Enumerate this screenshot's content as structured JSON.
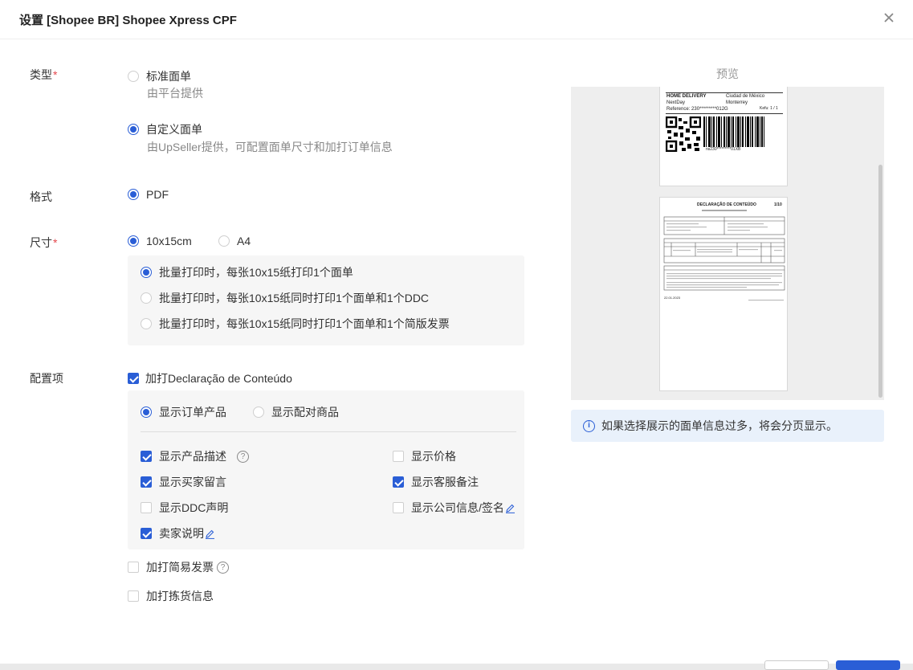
{
  "header": {
    "title": "设置 [Shopee BR] Shopee Xpress CPF"
  },
  "type": {
    "label": "类型",
    "options": [
      {
        "label": "标准面单",
        "desc": "由平台提供",
        "selected": false
      },
      {
        "label": "自定义面单",
        "desc": "由UpSeller提供，可配置面单尺寸和加打订单信息",
        "selected": true
      }
    ]
  },
  "format": {
    "label": "格式",
    "option": "PDF"
  },
  "size": {
    "label": "尺寸",
    "options": [
      "10x15cm",
      "A4"
    ],
    "print_modes": [
      "批量打印时，每张10x15纸打印1个面单",
      "批量打印时，每张10x15纸同时打印1个面单和1个DDC",
      "批量打印时，每张10x15纸同时打印1个面单和1个简版发票"
    ]
  },
  "config": {
    "label": "配置项",
    "declaration": "加打Declaração de Conteúdo",
    "display_modes": [
      "显示订单产品",
      "显示配对商品"
    ],
    "checkboxes": [
      {
        "label": "显示产品描述",
        "checked": true
      },
      {
        "label": "显示价格",
        "checked": false
      },
      {
        "label": "显示买家留言",
        "checked": true
      },
      {
        "label": "显示客服备注",
        "checked": true
      },
      {
        "label": "显示DDC声明",
        "checked": false
      },
      {
        "label": "显示公司信息/签名",
        "checked": false
      },
      {
        "label": "卖家说明",
        "checked": true
      }
    ],
    "simple_invoice": "加打简易发票",
    "picking_info": "加打拣货信息"
  },
  "preview": {
    "title": "预览",
    "label_text": {
      "home_delivery": "HOME DELIVERY",
      "next_day": "NextDay",
      "reference": "Reference: 230*********012G",
      "city": "Ciudad de México",
      "state": "Monterrey",
      "kefu": "Kefu: 1 / 1",
      "barcode_text": "ns230*********01XB"
    },
    "declaration_text": {
      "title": "DECLARAÇÃO DE CONTEÚDO",
      "page": "1/10",
      "date": "22.01.2023"
    },
    "notice": "如果选择展示的面单信息过多，将会分页显示。"
  }
}
